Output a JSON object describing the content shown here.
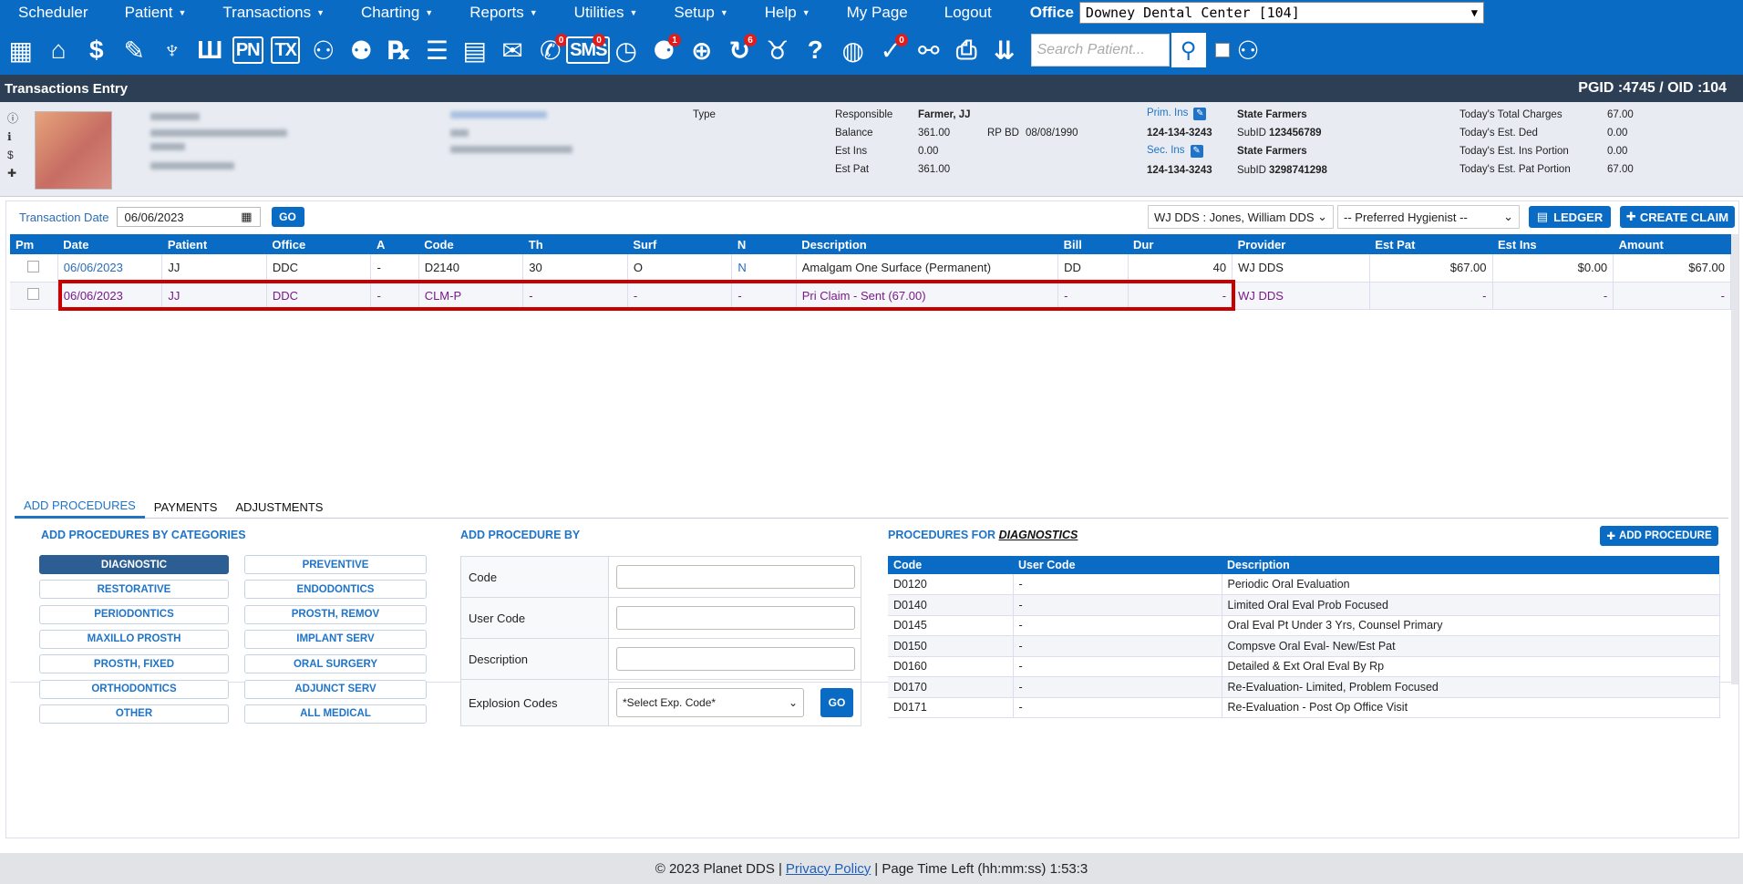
{
  "menu": {
    "items": [
      {
        "label": "Scheduler",
        "caret": false
      },
      {
        "label": "Patient",
        "caret": true
      },
      {
        "label": "Transactions",
        "caret": true
      },
      {
        "label": "Charting",
        "caret": true
      },
      {
        "label": "Reports",
        "caret": true
      },
      {
        "label": "Utilities",
        "caret": true
      },
      {
        "label": "Setup",
        "caret": true
      },
      {
        "label": "Help",
        "caret": true
      },
      {
        "label": "My Page",
        "caret": false
      },
      {
        "label": "Logout",
        "caret": false
      }
    ],
    "office_label": "Office",
    "office_value": "Downey Dental Center [104]"
  },
  "toolbar": {
    "icons": [
      {
        "name": "calendar-icon",
        "glyph": "▦"
      },
      {
        "name": "home-icon",
        "glyph": "⌂"
      },
      {
        "name": "dollar-icon",
        "glyph": "$"
      },
      {
        "name": "edit-icon",
        "glyph": "✎"
      },
      {
        "name": "tooth-chart-icon",
        "glyph": "♆"
      },
      {
        "name": "perio-icon",
        "glyph": "Ш"
      },
      {
        "name": "progress-notes-icon",
        "text": "PN"
      },
      {
        "name": "treatment-icon",
        "text": "TX"
      },
      {
        "name": "add-patient-icon",
        "glyph": "⚇"
      },
      {
        "name": "add-family-icon",
        "glyph": "⚉"
      },
      {
        "name": "prescription-icon",
        "glyph": "℞"
      },
      {
        "name": "notes-icon",
        "glyph": "☰"
      },
      {
        "name": "document-icon",
        "glyph": "▤"
      },
      {
        "name": "mail-icon",
        "glyph": "✉"
      },
      {
        "name": "messages-icon",
        "glyph": "✆",
        "badge": "0"
      },
      {
        "name": "sms-icon",
        "text": "SMS",
        "badge": "0"
      },
      {
        "name": "clock-icon",
        "glyph": "◷"
      },
      {
        "name": "online-users-icon",
        "glyph": "⚈",
        "badge": "1"
      },
      {
        "name": "global-icon",
        "glyph": "⊕"
      },
      {
        "name": "refresh-icon",
        "glyph": "↻",
        "badge": "6"
      },
      {
        "name": "tooth-icon",
        "glyph": "♉"
      },
      {
        "name": "help-tooth-icon",
        "glyph": "?"
      },
      {
        "name": "web-icon",
        "glyph": "◍"
      },
      {
        "name": "claims-icon",
        "glyph": "✓",
        "badge": "0"
      },
      {
        "name": "family-icon",
        "glyph": "⚯"
      },
      {
        "name": "print-icon",
        "glyph": "⎙"
      },
      {
        "name": "download-icon",
        "glyph": "⇊"
      }
    ],
    "search_placeholder": "Search Patient..."
  },
  "header": {
    "title": "Transactions Entry",
    "ids": "PGID :4745  /  OID :104"
  },
  "patient": {
    "type_label": "Type",
    "responsible_label": "Responsible",
    "responsible_value": "Farmer, JJ",
    "balance_label": "Balance",
    "balance_value": "361.00",
    "rpbd_label": "RP BD",
    "rpbd_value": "08/08/1990",
    "est_ins_label": "Est Ins",
    "est_ins_value": "0.00",
    "est_pat_label": "Est Pat",
    "est_pat_value": "361.00",
    "prim_ins_label": "Prim. Ins",
    "prim_ins_id": "124-134-3243",
    "prim_ins_name": "State Farmers",
    "prim_subid_label": "SubID",
    "prim_subid_value": "123456789",
    "sec_ins_label": "Sec. Ins",
    "sec_ins_id": "124-134-3243",
    "sec_ins_name": "State Farmers",
    "sec_subid_label": "SubID",
    "sec_subid_value": "3298741298",
    "totals": [
      {
        "label": "Today's Total Charges",
        "value": "67.00"
      },
      {
        "label": "Today's Est. Ded",
        "value": "0.00"
      },
      {
        "label": "Today's Est. Ins Portion",
        "value": "0.00"
      },
      {
        "label": "Today's Est. Pat Portion",
        "value": "67.00"
      }
    ]
  },
  "transactions": {
    "date_label": "Transaction Date",
    "date_value": "06/06/2023",
    "go_label": "GO",
    "provider_select": "WJ DDS : Jones, William DDS",
    "hygienist_select": "-- Preferred Hygienist --",
    "ledger_label": "LEDGER",
    "create_claim_label": "CREATE CLAIM",
    "columns": [
      "Pm",
      "Date",
      "Patient",
      "Office",
      "A",
      "Code",
      "Th",
      "Surf",
      "N",
      "Description",
      "Bill",
      "Dur",
      "Provider",
      "Est Pat",
      "Est Ins",
      "Amount"
    ],
    "rows": [
      {
        "date": "06/06/2023",
        "patient": "JJ",
        "office": "DDC",
        "a": "-",
        "code": "D2140",
        "th": "30",
        "surf": "O",
        "n": "N",
        "description": "Amalgam One Surface (Permanent)",
        "bill": "DD",
        "dur": "40",
        "provider": "WJ DDS",
        "est_pat": "$67.00",
        "est_ins": "$0.00",
        "amount": "$67.00"
      },
      {
        "date": "06/06/2023",
        "patient": "JJ",
        "office": "DDC",
        "a": "-",
        "code": "CLM-P",
        "th": "-",
        "surf": "-",
        "n": "-",
        "description": "Pri Claim - Sent (67.00)",
        "bill": "-",
        "dur": "-",
        "provider": "WJ DDS",
        "est_pat": "-",
        "est_ins": "-",
        "amount": "-"
      }
    ]
  },
  "lower": {
    "tabs": [
      "ADD PROCEDURES",
      "PAYMENTS",
      "ADJUSTMENTS"
    ],
    "categories_title": "ADD PROCEDURES BY CATEGORIES",
    "categories": [
      [
        "DIAGNOSTIC",
        "PREVENTIVE"
      ],
      [
        "RESTORATIVE",
        "ENDODONTICS"
      ],
      [
        "PERIODONTICS",
        "PROSTH, REMOV"
      ],
      [
        "MAXILLO PROSTH",
        "IMPLANT SERV"
      ],
      [
        "PROSTH, FIXED",
        "ORAL SURGERY"
      ],
      [
        "ORTHODONTICS",
        "ADJUNCT SERV"
      ],
      [
        "OTHER",
        "ALL MEDICAL"
      ]
    ],
    "add_by_title": "ADD PROCEDURE BY",
    "add_by_fields": {
      "code": "Code",
      "user_code": "User Code",
      "description": "Description",
      "explosion": "Explosion Codes"
    },
    "explosion_select": "*Select Exp. Code*",
    "explosion_go": "GO",
    "procedures_title": "PROCEDURES FOR",
    "procedures_category": "DIAGNOSTICS",
    "add_procedure_label": "ADD PROCEDURE",
    "proc_columns": [
      "Code",
      "User Code",
      "Description"
    ],
    "procedures": [
      {
        "code": "D0120",
        "user_code": "-",
        "description": "Periodic Oral Evaluation"
      },
      {
        "code": "D0140",
        "user_code": "-",
        "description": "Limited Oral Eval Prob Focused"
      },
      {
        "code": "D0145",
        "user_code": "-",
        "description": "Oral Eval Pt Under 3 Yrs, Counsel Primary"
      },
      {
        "code": "D0150",
        "user_code": "-",
        "description": "Compsve Oral Eval- New/Est Pat"
      },
      {
        "code": "D0160",
        "user_code": "-",
        "description": "Detailed & Ext Oral Eval By Rp"
      },
      {
        "code": "D0170",
        "user_code": "-",
        "description": "Re-Evaluation- Limited, Problem Focused"
      },
      {
        "code": "D0171",
        "user_code": "-",
        "description": "Re-Evaluation - Post Op Office Visit"
      }
    ]
  },
  "footer": {
    "copyright": "© 2023 Planet DDS |",
    "privacy": "Privacy Policy",
    "time_left": "|  Page Time Left (hh:mm:ss) 1:53:3"
  }
}
